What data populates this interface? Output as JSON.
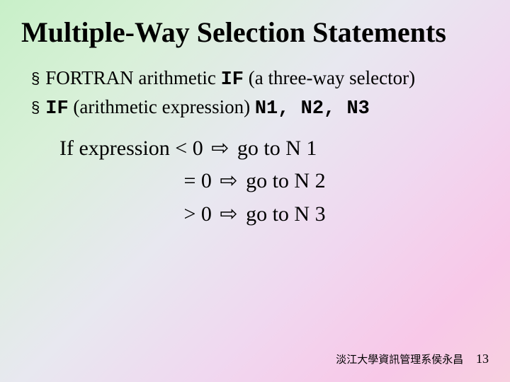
{
  "title": "Multiple-Way Selection Statements",
  "bullets": {
    "marker": "§",
    "b1_pre": "FORTRAN arithmetic ",
    "b1_code": "IF",
    "b1_post": " (a three-way selector)",
    "b2_code": "IF",
    "b2_mid": " (arithmetic expression) ",
    "b2_targets": "N1, N2, N3"
  },
  "explain": {
    "lead": "If expression",
    "arrow": "⇨",
    "rows": [
      {
        "cond": "< 0",
        "target": "go to N 1"
      },
      {
        "cond": "= 0",
        "target": "go to N 2"
      },
      {
        "cond": "> 0",
        "target": "go to N 3"
      }
    ]
  },
  "footer": {
    "org": "淡江大學資訊管理系侯永昌",
    "page": "13"
  }
}
